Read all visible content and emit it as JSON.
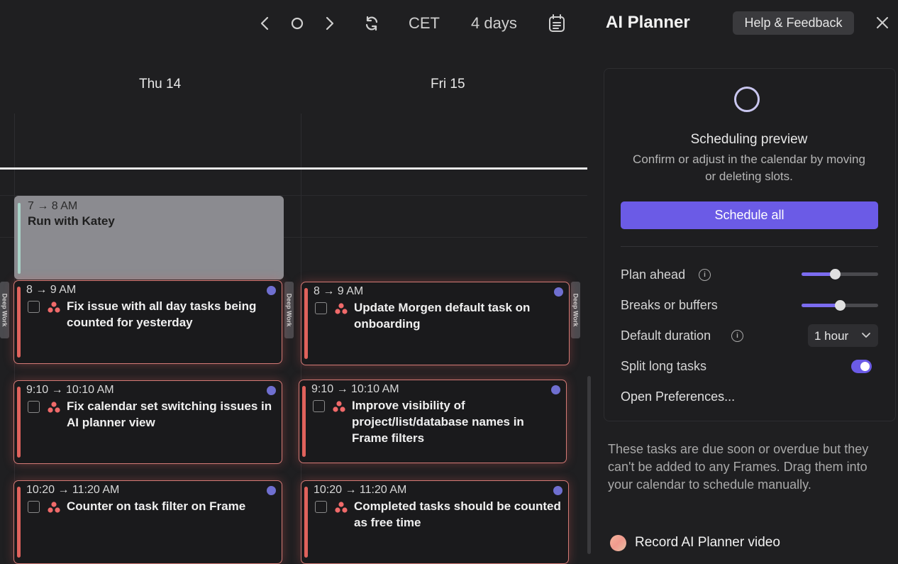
{
  "toolbar": {
    "prev_icon": "chevron-left-icon",
    "today_icon": "circle-icon",
    "next_icon": "chevron-right-icon",
    "refresh_icon": "refresh-icon",
    "timezone": "CET",
    "view_range": "4 days",
    "calendar_icon": "list-calendar-icon"
  },
  "calendar": {
    "days": [
      {
        "label": "Thu 14"
      },
      {
        "label": "Fri 15"
      }
    ],
    "deep_work_label": "Deep Work",
    "events": [
      {
        "time": "7 → 8 AM",
        "title": "Run with Katey"
      }
    ],
    "tasks_thu": [
      {
        "time": "8 → 9 AM",
        "title": "Fix issue with all day tasks being counted for yesterday"
      },
      {
        "time": "9:10 → 10:10 AM",
        "title": "Fix calendar set switching issues in AI planner view"
      },
      {
        "time": "10:20 → 11:20 AM",
        "title": "Counter on task filter on Frame"
      }
    ],
    "tasks_fri": [
      {
        "time": "8 → 9 AM",
        "title": "Update Morgen default task on onboarding"
      },
      {
        "time": "9:10 → 10:10 AM",
        "title": "Improve visibility of project/list/database names in Frame filters"
      },
      {
        "time": "10:20 → 11:20 AM",
        "title": "Completed tasks should be counted as free time"
      }
    ]
  },
  "panel": {
    "title": "AI Planner",
    "help_label": "Help & Feedback",
    "close_icon": "close-icon",
    "preview_title": "Scheduling preview",
    "preview_subtitle": "Confirm or adjust in the calendar by moving or deleting slots.",
    "schedule_all_label": "Schedule all",
    "options": {
      "plan_ahead": {
        "label": "Plan ahead",
        "level": 0.43
      },
      "breaks": {
        "label": "Breaks or buffers",
        "level": 0.5
      },
      "default_duration": {
        "label": "Default duration",
        "value": "1 hour"
      },
      "split_long_tasks": {
        "label": "Split long tasks",
        "enabled": true
      }
    },
    "open_preferences_label": "Open Preferences...",
    "due_text": "These tasks are due soon or overdue but they can't be added to any Frames. Drag them into your calendar to schedule manually.",
    "due_tasks": [
      {
        "title": "Record AI Planner video"
      }
    ]
  },
  "colors": {
    "accent": "#6b5be6",
    "task_border": "#d47a76",
    "task_bar": "#e0625c",
    "event_bg": "#8b8b90"
  }
}
